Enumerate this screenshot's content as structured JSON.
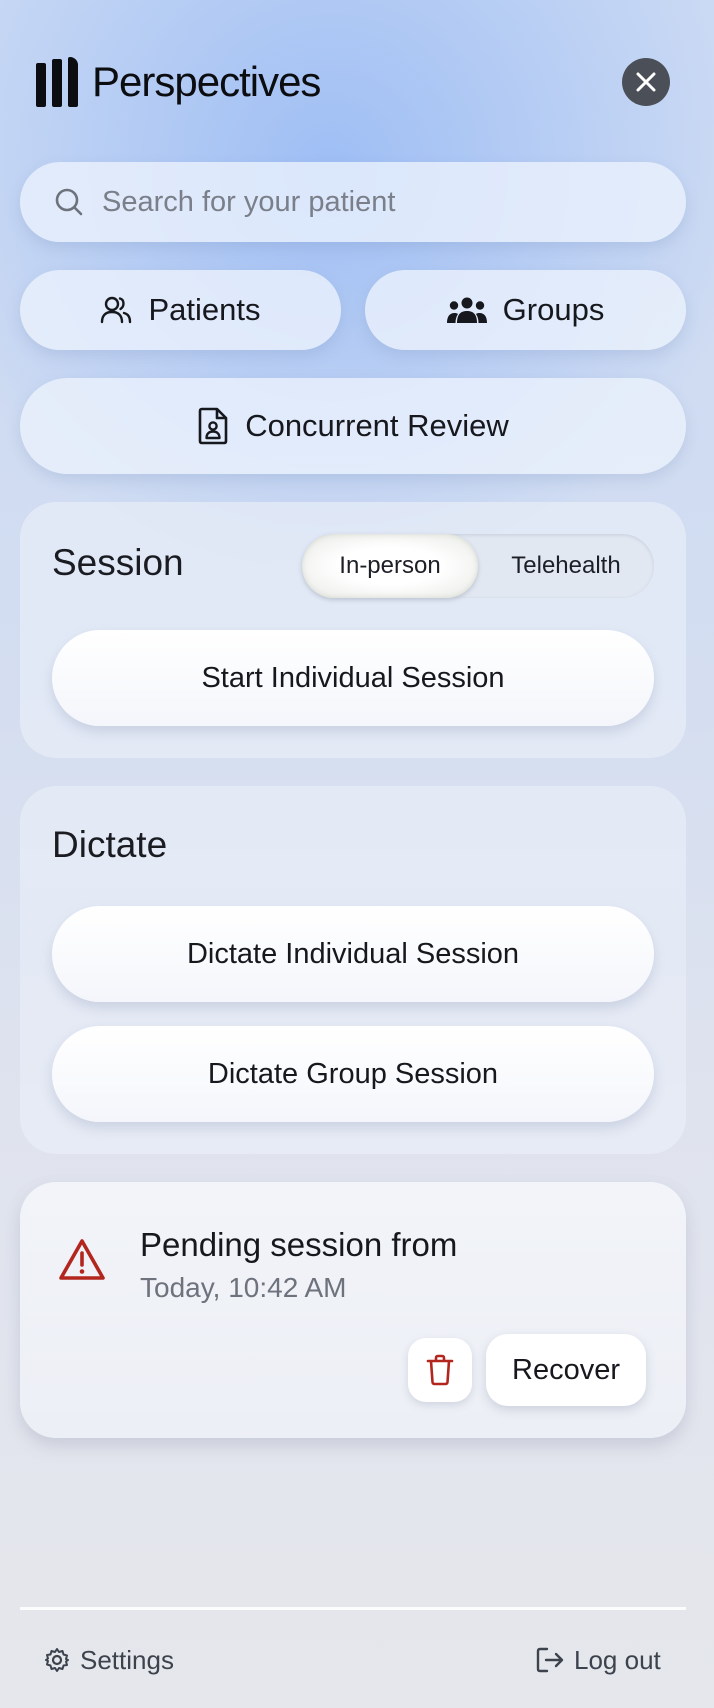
{
  "app": {
    "name": "Perspectives",
    "brand_icon": "perspectives-logo",
    "close_icon": "close-icon"
  },
  "search": {
    "placeholder": "Search for your patient",
    "icon": "search-icon"
  },
  "nav": {
    "patients_label": "Patients",
    "groups_label": "Groups",
    "concurrent_review_label": "Concurrent Review"
  },
  "session": {
    "title": "Session",
    "modes": [
      "In-person",
      "Telehealth"
    ],
    "selected_mode": "In-person",
    "start_label": "Start Individual Session"
  },
  "dictate": {
    "title": "Dictate",
    "individual_label": "Dictate Individual Session",
    "group_label": "Dictate Group Session"
  },
  "pending": {
    "title": "Pending session from",
    "time": "Today, 10:42 AM",
    "recover_label": "Recover",
    "warning_color": "#b3261e"
  },
  "footer": {
    "settings_label": "Settings",
    "logout_label": "Log out"
  }
}
